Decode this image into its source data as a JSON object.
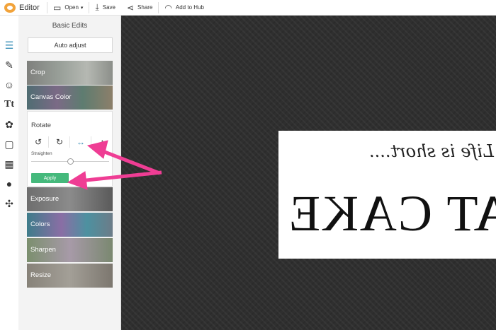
{
  "topbar": {
    "app_title": "Editor",
    "items": [
      {
        "label": "Open",
        "icon": "folder-icon"
      },
      {
        "label": "Save",
        "icon": "save-icon"
      },
      {
        "label": "Share",
        "icon": "share-icon"
      },
      {
        "label": "Add to Hub",
        "icon": "headphones-icon"
      }
    ]
  },
  "rail": {
    "icons": [
      "sliders-icon",
      "magic-wand-icon",
      "face-icon",
      "text-icon",
      "butterfly-icon",
      "frame-icon",
      "texture-icon",
      "apple-icon",
      "collage-icon"
    ]
  },
  "panel": {
    "title": "Basic Edits",
    "auto_adjust": "Auto adjust",
    "tiles": {
      "crop": "Crop",
      "canvas_color": "Canvas Color",
      "exposure": "Exposure",
      "colors": "Colors",
      "sharpen": "Sharpen",
      "resize": "Resize"
    },
    "rotate": {
      "label": "Rotate",
      "straighten_label": "Straighten",
      "apply": "Apply",
      "buttons": [
        "rotate-left-icon",
        "rotate-right-icon",
        "flip-horizontal-icon",
        "flip-vertical-icon"
      ],
      "selected": "flip-horizontal-icon"
    }
  },
  "canvas": {
    "image_text_script": "Life is short....",
    "image_text_big": "EAT CAKE"
  },
  "colors": {
    "accent": "#3a8fb7",
    "apply_button": "#45b97c",
    "annotation_arrow": "#ef3d94",
    "canvas_bg": "#2f2f2f"
  }
}
